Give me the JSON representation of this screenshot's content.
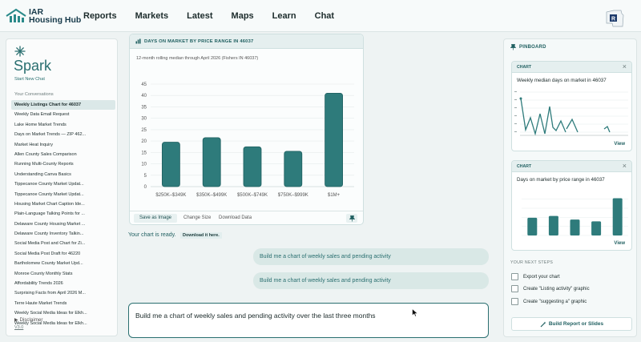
{
  "brand": {
    "name_line1": "IAR",
    "name_line2": "Housing Hub"
  },
  "nav": [
    "Reports",
    "Markets",
    "Latest",
    "Maps",
    "Learn",
    "Chat"
  ],
  "sidebar": {
    "title": "Spark",
    "new_chat": "Start New Chat",
    "conversations_heading": "Your Conversations",
    "conversations": [
      "Weekly Listings Chart for 46037",
      "Weekly Data Email Request",
      "Lake Home Market Trends",
      "Days on Market Trends — ZIP 462...",
      "Market Heat Inquiry",
      "Allen County Sales Comparison",
      "Running Multi-County Reports",
      "Understanding Canva Basics",
      "Tippecanoe County Market Updat...",
      "Tippecanoe County Market Updat...",
      "Housing Market Chart Caption Ide...",
      "Plain-Language Talking Points for ...",
      "Delaware County Housing Market ...",
      "Delaware County Inventory Talkin...",
      "Social Media Post and Chart for Zi...",
      "Social Media Post Draft for 46220",
      "Bartholomew County Market Upd...",
      "Monroe County Monthly Stats",
      "Affordability Trends 2026",
      "Surprising Facts from April 2026 M...",
      "Terre Haute Market Trends",
      "Weekly Social Media Ideas for Elkh...",
      "Weekly Social Media Ideas for Elkh..."
    ],
    "disclaimer": "Disclaimer",
    "version": "V3.0"
  },
  "main_chart": {
    "header": "DAYS ON MARKET BY PRICE RANGE IN 46037",
    "subtitle": "12-month rolling median through April 2026 (Fishers IN 46037)",
    "actions": {
      "save": "Save as Image",
      "resize": "Change Size",
      "download": "Download Data"
    }
  },
  "chart_data": {
    "type": "bar",
    "categories": [
      "$250K–$349K",
      "$350K–$499K",
      "$500K–$749K",
      "$750K–$999K",
      "$1M+"
    ],
    "values": [
      19.5,
      21.5,
      17.5,
      15.5,
      41
    ],
    "ylim": [
      0,
      45
    ],
    "yticks": [
      0,
      5,
      10,
      15,
      20,
      25,
      30,
      35,
      40,
      45
    ],
    "grid": true,
    "color": "#2e7b7b"
  },
  "chat": {
    "ready_text": "Your chart is ready.",
    "download_link": "Download it here.",
    "bubbles": [
      "Build me a chart of weekly sales and pending activity",
      "Build me a chart of weekly sales and pending activity"
    ],
    "input_value": "Build me a chart of weekly sales and pending activity over the last three months"
  },
  "pinboard": {
    "title": "PINBOARD",
    "cards": [
      {
        "tag": "CHART",
        "title": "Weekly median days on market in 46037",
        "view": "View"
      },
      {
        "tag": "CHART",
        "title": "Days on market by price range in 46037",
        "view": "View"
      }
    ],
    "next_steps_heading": "YOUR NEXT STEPS",
    "next_steps": [
      "Export your chart",
      "Create \"Listing activity\" graphic",
      "Create \"suggesting a\" graphic"
    ],
    "build_button": "Build Report or Slides"
  },
  "colors": {
    "accent": "#2a6f70",
    "bar": "#2e7b7b"
  }
}
